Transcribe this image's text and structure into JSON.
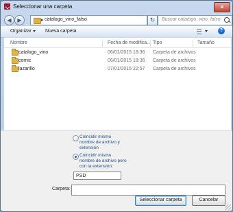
{
  "window": {
    "title": "Seleccionar una carpeta",
    "close_label": "×"
  },
  "nav": {
    "back_label": "◀",
    "forward_label": "▶",
    "path_separator": "▸",
    "path": "catalogo_vino_falso",
    "path_dropdown": "▾",
    "refresh_label": "↻",
    "search_placeholder": "Buscar catalogo_vino_falso"
  },
  "toolbar": {
    "organize_label": "Organizar",
    "new_folder_label": "Nueva carpeta",
    "help_label": "?"
  },
  "columns": {
    "name": "Nombre",
    "date": "Fecha de modifica...",
    "type": "Tipo",
    "size": "Tamaño"
  },
  "rows": [
    {
      "name": "catalogo_vino",
      "date": "06/01/2015 18:36",
      "type": "Carpeta de archivos"
    },
    {
      "name": "comic",
      "date": "06/01/2015 18:36",
      "type": "Carpeta de archivos"
    },
    {
      "name": "lazarillo",
      "date": "07/01/2015 22:57",
      "type": "Carpeta de archivos"
    }
  ],
  "options": {
    "match_name_ext": "Coincidir mismo nombre de archivo y extensión",
    "match_name_other_ext": "Coincidir mismo nombre de archivo pero con la extensión:",
    "extension": "PSD"
  },
  "folder": {
    "label": "Carpeta:",
    "value": ""
  },
  "buttons": {
    "select": "Seleccionar carpeta",
    "cancel": "Cancelar"
  },
  "colors": {
    "window_chrome": "#b5cbe4",
    "folder": "#dfb34c",
    "accent": "#1f4f88",
    "close": "#c44536"
  }
}
